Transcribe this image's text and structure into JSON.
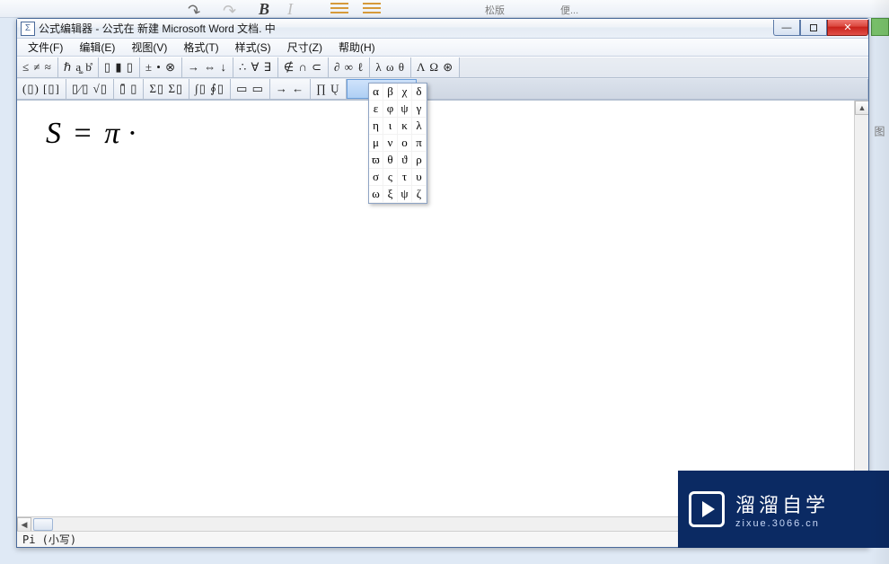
{
  "bg": {
    "bold": "B",
    "italic": "I",
    "label_layout": "松版",
    "label_other": "便..."
  },
  "window": {
    "title": "公式编辑器 - 公式在 新建 Microsoft Word 文档. 中"
  },
  "menus": [
    "文件(F)",
    "编辑(E)",
    "视图(V)",
    "格式(T)",
    "样式(S)",
    "尺寸(Z)",
    "帮助(H)"
  ],
  "toolbar_row1": [
    "≤ ≠ ≈",
    "ℏ a͚ b̊",
    "▯ ▮ ▯",
    "± • ⊗",
    "→ ⇔ ↓",
    "∴ ∀ ∃",
    "∉ ∩ ⊂",
    "∂ ∞ ℓ",
    "λ ω θ",
    "Λ Ω ⊛"
  ],
  "toolbar_row2": [
    "(▯) [▯]",
    "▯⁄▯ √▯",
    "▯̄  ▯",
    "Σ▯ Σ▯",
    "∫▯ ∮▯",
    "▭ ▭",
    "→  ←",
    "∏ Ų",
    "greek"
  ],
  "greek_letters": [
    "α",
    "β",
    "χ",
    "δ",
    "ε",
    "φ",
    "ψ",
    "γ",
    "η",
    "ι",
    "κ",
    "λ",
    "μ",
    "ν",
    "ο",
    "π",
    "ϖ",
    "θ",
    "ϑ",
    "ρ",
    "σ",
    "ς",
    "τ",
    "υ",
    "ω",
    "ξ",
    "ψ",
    "ζ"
  ],
  "equation": {
    "lhs": "S",
    "op": "=",
    "rhs": "π",
    "trail": "·"
  },
  "status": "Pi (小写)",
  "watermark": {
    "ch": "溜溜自学",
    "en": "zixue.3066.cn"
  }
}
